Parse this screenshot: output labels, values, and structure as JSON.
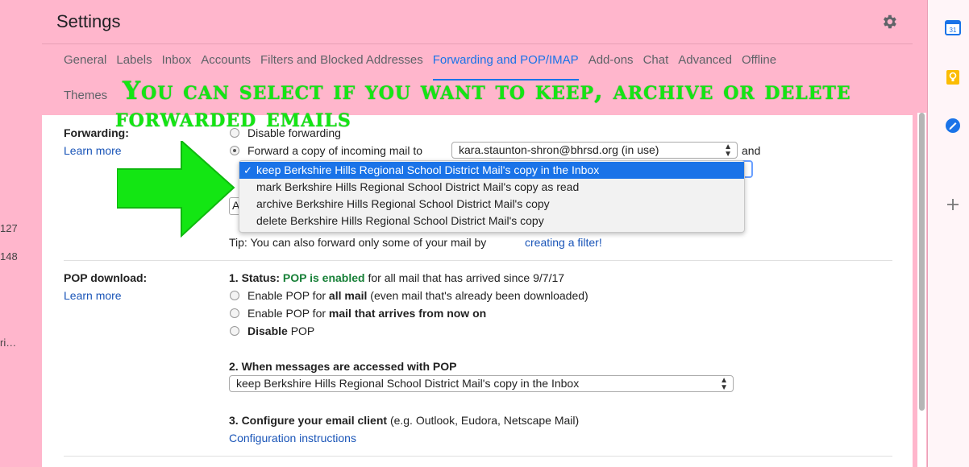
{
  "left_strip": {
    "nums": [
      "127",
      "148",
      "ri…"
    ]
  },
  "header": {
    "title": "Settings",
    "gear_icon": "gear-icon"
  },
  "tabs": [
    {
      "label": "General",
      "active": false
    },
    {
      "label": "Labels",
      "active": false
    },
    {
      "label": "Inbox",
      "active": false
    },
    {
      "label": "Accounts",
      "active": false
    },
    {
      "label": "Filters and Blocked Addresses",
      "active": false
    },
    {
      "label": "Forwarding and POP/IMAP",
      "active": true
    },
    {
      "label": "Add-ons",
      "active": false
    },
    {
      "label": "Chat",
      "active": false
    },
    {
      "label": "Advanced",
      "active": false
    },
    {
      "label": "Offline",
      "active": false
    }
  ],
  "tabs_row2": {
    "label": "Themes"
  },
  "annotation": {
    "line1": "You can select if you want to keep, archive or delete",
    "line2": "forwarded emails",
    "color": "#13e613"
  },
  "forwarding": {
    "label": "Forwarding:",
    "learn_more": "Learn more",
    "disable_option": "Disable forwarding",
    "forward_option": "Forward a copy of incoming mail to",
    "forward_address": "kara.staunton-shron@bhrsd.org (in use)",
    "and_text": "and",
    "partial_button": "A",
    "dropdown_options": [
      {
        "label": "keep Berkshire Hills Regional School District Mail's copy in the Inbox",
        "selected": true
      },
      {
        "label": "mark Berkshire Hills Regional School District Mail's copy as read",
        "selected": false
      },
      {
        "label": "archive Berkshire Hills Regional School District Mail's copy",
        "selected": false
      },
      {
        "label": "delete Berkshire Hills Regional School District Mail's copy",
        "selected": false
      }
    ],
    "tip_text": "Tip: You can also forward only some of your mail by",
    "tip_link": "creating a filter!"
  },
  "pop": {
    "label": "POP download:",
    "learn_more": "Learn more",
    "status_prefix": "1. Status:",
    "status_value": "POP is enabled",
    "status_suffix": "for all mail that has arrived since 9/7/17",
    "status_color": "#188038",
    "opt1_prefix": "Enable POP for",
    "opt1_bold": "all mail",
    "opt1_suffix": "(even mail that's already been downloaded)",
    "opt2_prefix": "Enable POP for",
    "opt2_bold": "mail that arrives from now on",
    "opt3_bold": "Disable",
    "opt3_suffix": "POP",
    "section2_title": "2. When messages are accessed with POP",
    "section2_select": "keep Berkshire Hills Regional School District Mail's copy in the Inbox",
    "section3_title": "3. Configure your email client",
    "section3_suffix": "(e.g. Outlook, Eudora, Netscape Mail)",
    "config_link": "Configuration instructions"
  },
  "right_side": {
    "icons": [
      "calendar-icon",
      "keep-icon",
      "tasks-icon",
      "add-icon"
    ],
    "calendar_day": "31"
  }
}
